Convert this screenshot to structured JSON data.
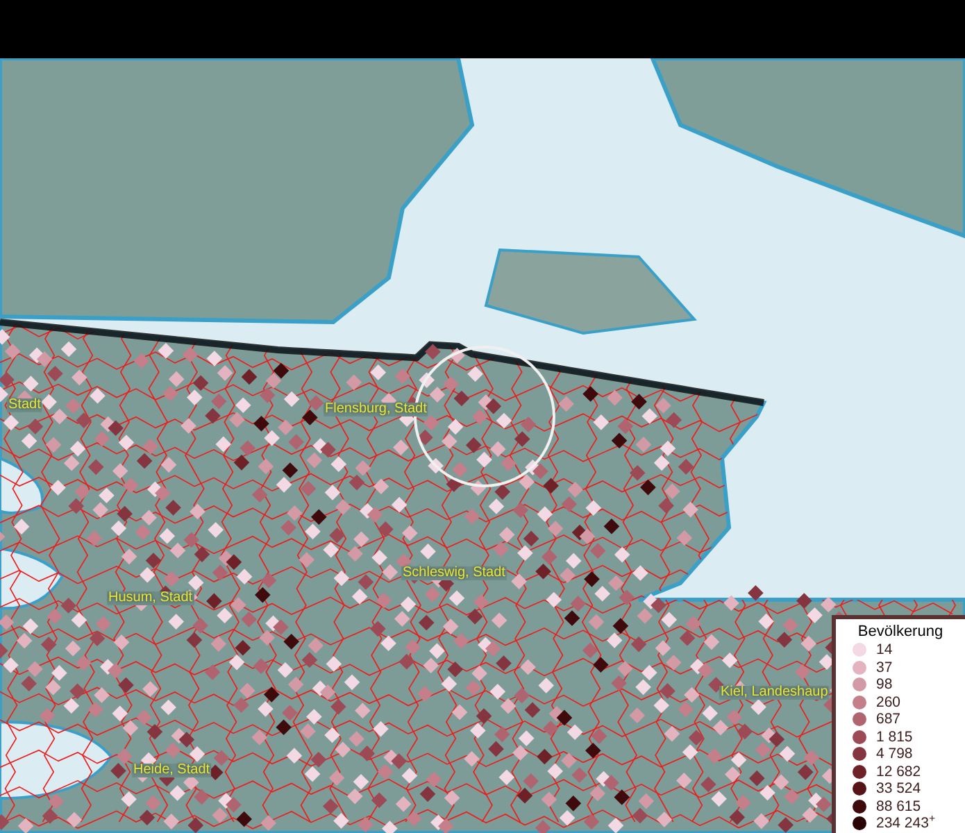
{
  "map_labels": [
    {
      "text": "Stadt"
    },
    {
      "text": "Flensburg, Stadt"
    },
    {
      "text": "Schleswig, Stadt"
    },
    {
      "text": "Husum, Stadt"
    },
    {
      "text": "Kiel, Landeshaup"
    },
    {
      "text": "Heide, Stadt"
    }
  ],
  "legend": {
    "title": "Bevölkerung",
    "items": [
      {
        "label": "14",
        "color": "#f3d9e3"
      },
      {
        "label": "37",
        "color": "#e3b4c0"
      },
      {
        "label": "98",
        "color": "#d39aa6"
      },
      {
        "label": "260",
        "color": "#c47f8a"
      },
      {
        "label": "687",
        "color": "#b06470"
      },
      {
        "label": "1 815",
        "color": "#9c4a55"
      },
      {
        "label": "4 798",
        "color": "#853540"
      },
      {
        "label": "12 682",
        "color": "#6e2228"
      },
      {
        "label": "33 524",
        "color": "#561418"
      },
      {
        "label": "88 615",
        "color": "#3e0a0c"
      },
      {
        "label": "234 243$^{+}$",
        "color": "#2a0404"
      }
    ]
  }
}
